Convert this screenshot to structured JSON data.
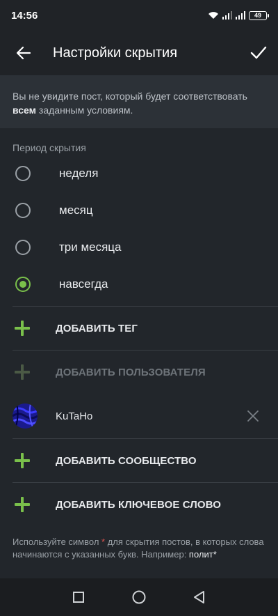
{
  "status_bar": {
    "time": "14:56",
    "battery": "49"
  },
  "toolbar": {
    "title": "Настройки скрытия"
  },
  "info": {
    "text_before": "Вы не увидите пост, который будет соответствовать ",
    "text_bold": "всем",
    "text_after": " заданным условиям."
  },
  "period": {
    "title": "Период скрытия",
    "options": [
      {
        "label": "неделя",
        "checked": false
      },
      {
        "label": "месяц",
        "checked": false
      },
      {
        "label": "три месяца",
        "checked": false
      },
      {
        "label": "навсегда",
        "checked": true
      }
    ]
  },
  "actions": {
    "add_tag": "ДОБАВИТЬ ТЕГ",
    "add_user": "ДОБАВИТЬ ПОЛЬЗОВАТЕЛЯ",
    "add_community": "ДОБАВИТЬ СООБЩЕСТВО",
    "add_keyword": "ДОБАВИТЬ КЛЮЧЕВОЕ СЛОВО"
  },
  "user": {
    "name": "KuTaHo"
  },
  "hint": {
    "part1": "Используйте символ ",
    "star": "*",
    "part2": " для скрытия постов, в которых слова начинаются с указанных букв. Например: ",
    "example": "полит*"
  },
  "colors": {
    "accent": "#7ac04b",
    "background": "#22262b",
    "info_bg": "#2c3137"
  }
}
